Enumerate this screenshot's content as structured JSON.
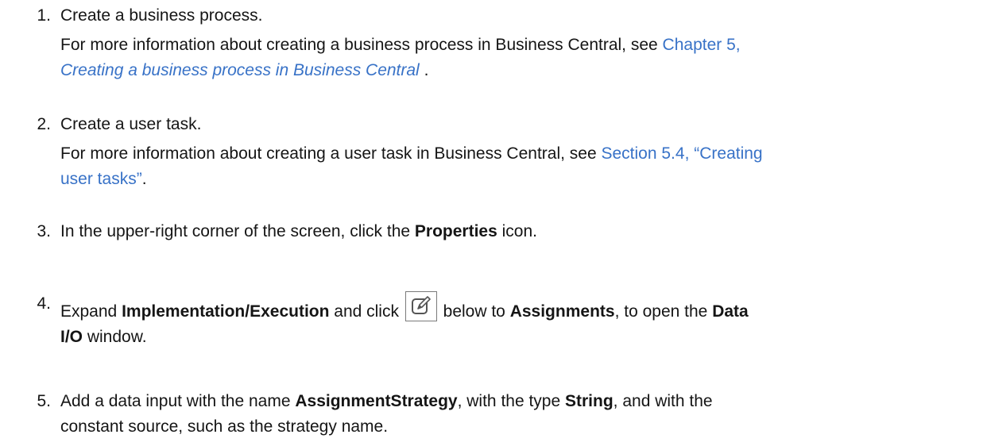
{
  "steps": [
    {
      "number": "1.",
      "title": "Create a business process.",
      "detail_prefix": "For more information about creating a business process in Business Central, see ",
      "link_line1": "Chapter 5,",
      "link_line2": "Creating a business process in Business Central",
      "detail_suffix": " ."
    },
    {
      "number": "2.",
      "title": "Create a user task.",
      "detail_prefix": "For more information about creating a user task in Business Central, see ",
      "link_line1": "Section 5.4, “Creating",
      "link_line2": "user tasks”",
      "detail_suffix": "."
    },
    {
      "number": "3.",
      "text_before": "In the upper-right corner of the screen, click the ",
      "bold": "Properties",
      "text_after": " icon."
    },
    {
      "number": "4.",
      "text_before": "Expand ",
      "bold1": "Implementation/Execution",
      "text_mid": " and click ",
      "icon": "edit-icon",
      "text_mid2": " below to ",
      "bold2": "Assignments",
      "text_mid3": ", to open the ",
      "bold3_line1": "Data",
      "bold3_line2": "I/O",
      "text_after": " window."
    },
    {
      "number": "5.",
      "text_before": "Add a data input with the name ",
      "bold1": "AssignmentStrategy",
      "text_mid": ", with the type ",
      "bold2": "String",
      "text_mid2": ", and with the",
      "line2": "constant source, such as the strategy name."
    }
  ],
  "colors": {
    "text": "#151515",
    "link": "#3872c7"
  }
}
